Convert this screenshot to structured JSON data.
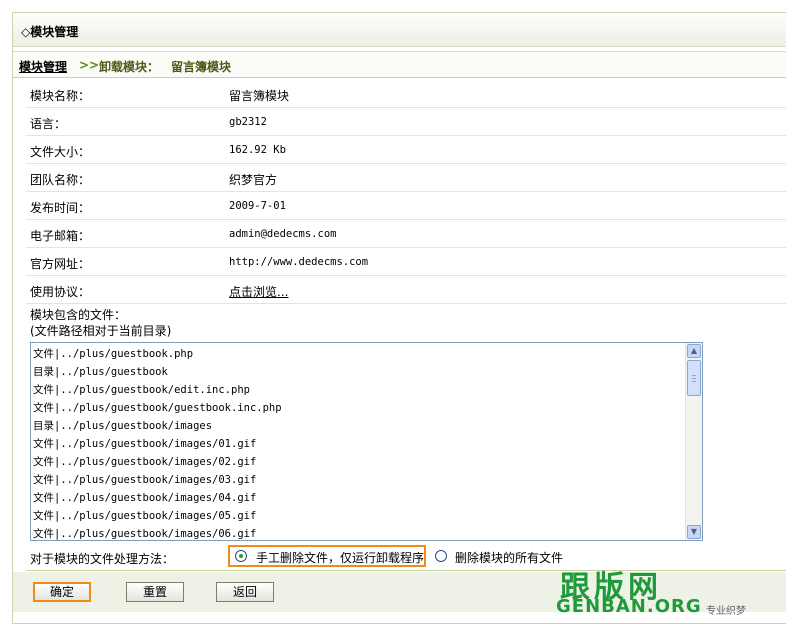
{
  "header": {
    "title": "◇模块管理"
  },
  "breadcrumb": {
    "home": "模块管理",
    "arrow": ">>",
    "step1": "卸载模块：",
    "step2": "留言簿模块"
  },
  "info": [
    {
      "label": "模块名称：",
      "value": "留言簿模块"
    },
    {
      "label": "语言：",
      "value": "gb2312"
    },
    {
      "label": "文件大小：",
      "value": "162.92 Kb"
    },
    {
      "label": "团队名称：",
      "value": "织梦官方"
    },
    {
      "label": "发布时间：",
      "value": "2009-7-01"
    },
    {
      "label": "电子邮箱：",
      "value": "admin@dedecms.com"
    },
    {
      "label": "官方网址：",
      "value": "http://www.dedecms.com"
    },
    {
      "label": "使用协议：",
      "value": "点击浏览..."
    }
  ],
  "files": {
    "label_line1": "模块包含的文件：",
    "label_line2": "(文件路径相对于当前目录)",
    "lines": [
      "文件|../plus/guestbook.php",
      "目录|../plus/guestbook",
      "文件|../plus/guestbook/edit.inc.php",
      "文件|../plus/guestbook/guestbook.inc.php",
      "目录|../plus/guestbook/images",
      "文件|../plus/guestbook/images/01.gif",
      "文件|../plus/guestbook/images/02.gif",
      "文件|../plus/guestbook/images/03.gif",
      "文件|../plus/guestbook/images/04.gif",
      "文件|../plus/guestbook/images/05.gif",
      "文件|../plus/guestbook/images/06.gif"
    ]
  },
  "method": {
    "label": "对于模块的文件处理方法：",
    "option1": "手工删除文件，仅运行卸载程序",
    "option2": "删除模块的所有文件",
    "selected": "option1"
  },
  "buttons": {
    "ok": "确定",
    "reset": "重置",
    "back": "返回"
  },
  "watermark": {
    "cn": "跟版网",
    "en": "GENBAN.ORG",
    "sub": "专业织梦"
  },
  "colors": {
    "accent": "#f08a1a",
    "border": "#c7d39f",
    "brand": "#1f9a3a"
  }
}
